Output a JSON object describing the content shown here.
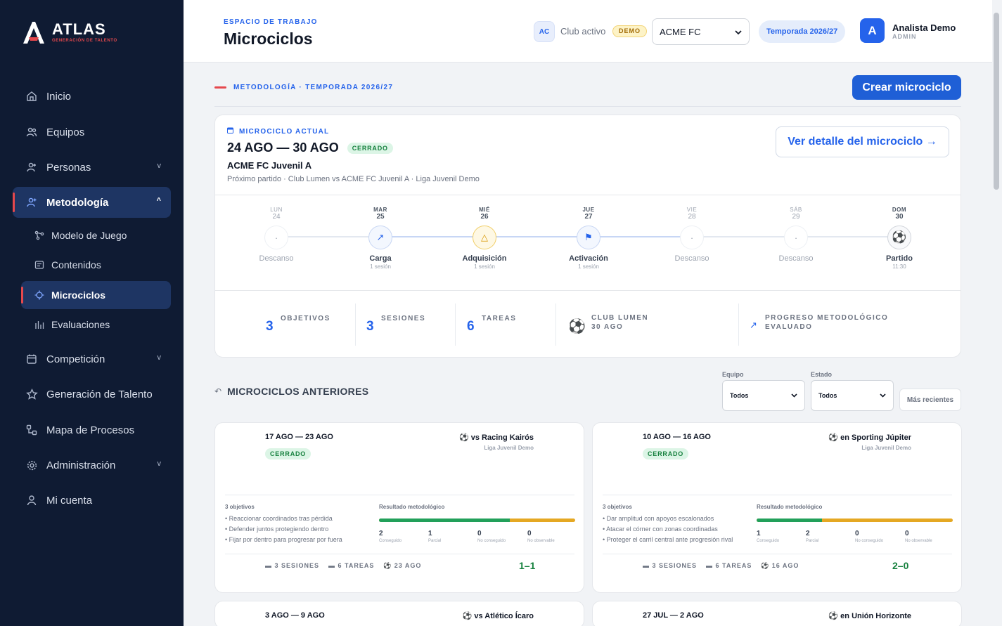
{
  "brand": {
    "title": "ATLAS",
    "subtitle": "GENERACIÓN DE TALENTO",
    "accent": "#e5484d",
    "primary": "#1f5fd6"
  },
  "sidebar": {
    "items": [
      {
        "label": "Inicio",
        "icon": "home-icon"
      },
      {
        "label": "Equipos",
        "icon": "users-icon"
      },
      {
        "label": "Personas",
        "icon": "person-icon",
        "chevron": "v"
      },
      {
        "label": "Metodología",
        "icon": "person-plus-icon",
        "chevron": "^"
      },
      {
        "label": "Competición",
        "icon": "calendar-icon",
        "chevron": "v"
      },
      {
        "label": "Generación de Talento",
        "icon": "star-icon"
      },
      {
        "label": "Mapa de Procesos",
        "icon": "process-icon"
      },
      {
        "label": "Administración",
        "icon": "gear-icon",
        "chevron": "v"
      },
      {
        "label": "Mi cuenta",
        "icon": "user-icon"
      }
    ],
    "subitems": [
      {
        "label": "Modelo de Juego",
        "icon": "graph-icon"
      },
      {
        "label": "Contenidos",
        "icon": "document-icon"
      },
      {
        "label": "Microciclos",
        "icon": "crosshair-icon"
      },
      {
        "label": "Evaluaciones",
        "icon": "chart-icon"
      }
    ]
  },
  "header": {
    "eyebrow": "ESPACIO DE TRABAJO",
    "title": "Microciclos",
    "club_initials": "AC",
    "club_label": "Club activo",
    "demo_badge": "DEMO",
    "club_select": "ACME FC",
    "season": "Temporada 2026/27",
    "user_initial": "A",
    "user_name": "Analista Demo",
    "user_role": "ADMIN"
  },
  "section": {
    "label": "METODOLOGÍA · TEMPORADA 2026/27",
    "create_button": "Crear microciclo"
  },
  "current": {
    "eyebrow": "MICROCICLO ACTUAL",
    "dates": "24 AGO — 30 AGO",
    "status": "CERRADO",
    "team": "ACME FC Juvenil A",
    "next": "Próximo partido · Club Lumen vs ACME FC Juvenil A · Liga Juvenil Demo",
    "detail_button": "Ver detalle del microciclo →",
    "days": [
      {
        "name": "LUN",
        "num": "24",
        "label": "Descanso",
        "sub": "",
        "glyph": "·"
      },
      {
        "name": "MAR",
        "num": "25",
        "label": "Carga",
        "sub": "1 sesión",
        "glyph": "↗"
      },
      {
        "name": "MIÉ",
        "num": "26",
        "label": "Adquisición",
        "sub": "1 sesión",
        "glyph": "△"
      },
      {
        "name": "JUE",
        "num": "27",
        "label": "Activación",
        "sub": "1 sesión",
        "glyph": "⚑"
      },
      {
        "name": "VIE",
        "num": "28",
        "label": "Descanso",
        "sub": "",
        "glyph": "·"
      },
      {
        "name": "SÁB",
        "num": "29",
        "label": "Descanso",
        "sub": "",
        "glyph": "·"
      },
      {
        "name": "DOM",
        "num": "30",
        "label": "Partido",
        "sub": "11:30",
        "glyph": "⚽"
      }
    ],
    "stats": {
      "objetivos": {
        "value": "3",
        "label": "OBJETIVOS"
      },
      "sesiones": {
        "value": "3",
        "label": "SESIONES"
      },
      "tareas": {
        "value": "6",
        "label": "TAREAS"
      },
      "match_line1": "CLUB LUMEN",
      "match_line2": "30 AGO",
      "progress_line1": "PROGRESO METODOLÓGICO",
      "progress_line2": "EVALUADO"
    }
  },
  "previous": {
    "title": "MICROCICLOS ANTERIORES",
    "filter_team_label": "Equipo",
    "filter_team_value": "Todos",
    "filter_state_label": "Estado",
    "filter_state_value": "Todos",
    "sort_button": "Más recientes",
    "cards": [
      {
        "dates": "17 AGO — 23 AGO",
        "status": "CERRADO",
        "opponent": "vs Racing Kairós",
        "league": "Liga Juvenil Demo",
        "obj_title": "3 objetivos",
        "objectives": [
          "• Reaccionar coordinados tras pérdida",
          "• Defender juntos protegiendo dentro",
          "• Fijar por dentro para progresar por fuera"
        ],
        "res_title": "Resultado metodológico",
        "green_fraction": 0.667,
        "counts": [
          {
            "n": "2",
            "l": "Conseguido"
          },
          {
            "n": "1",
            "l": "Parcial"
          },
          {
            "n": "0",
            "l": "No conseguido"
          },
          {
            "n": "0",
            "l": "No observable"
          }
        ],
        "sessions": "3 SESIONES",
        "tasks": "6 TAREAS",
        "match_date": "23 AGO",
        "score": "1–1"
      },
      {
        "dates": "10 AGO — 16 AGO",
        "status": "CERRADO",
        "opponent": "en Sporting Júpiter",
        "league": "Liga Juvenil Demo",
        "obj_title": "3 objetivos",
        "objectives": [
          "• Dar amplitud con apoyos escalonados",
          "• Atacar el córner con zonas coordinadas",
          "• Proteger el carril central ante progresión rival"
        ],
        "res_title": "Resultado metodológico",
        "green_fraction": 0.333,
        "counts": [
          {
            "n": "1",
            "l": "Conseguido"
          },
          {
            "n": "2",
            "l": "Parcial"
          },
          {
            "n": "0",
            "l": "No conseguido"
          },
          {
            "n": "0",
            "l": "No observable"
          }
        ],
        "sessions": "3 SESIONES",
        "tasks": "6 TAREAS",
        "match_date": "16 AGO",
        "score": "2–0"
      },
      {
        "dates": "3 AGO — 9 AGO",
        "opponent": "vs Atlético Ícaro"
      },
      {
        "dates": "27 JUL — 2 AGO",
        "opponent": "en Unión Horizonte"
      }
    ]
  }
}
